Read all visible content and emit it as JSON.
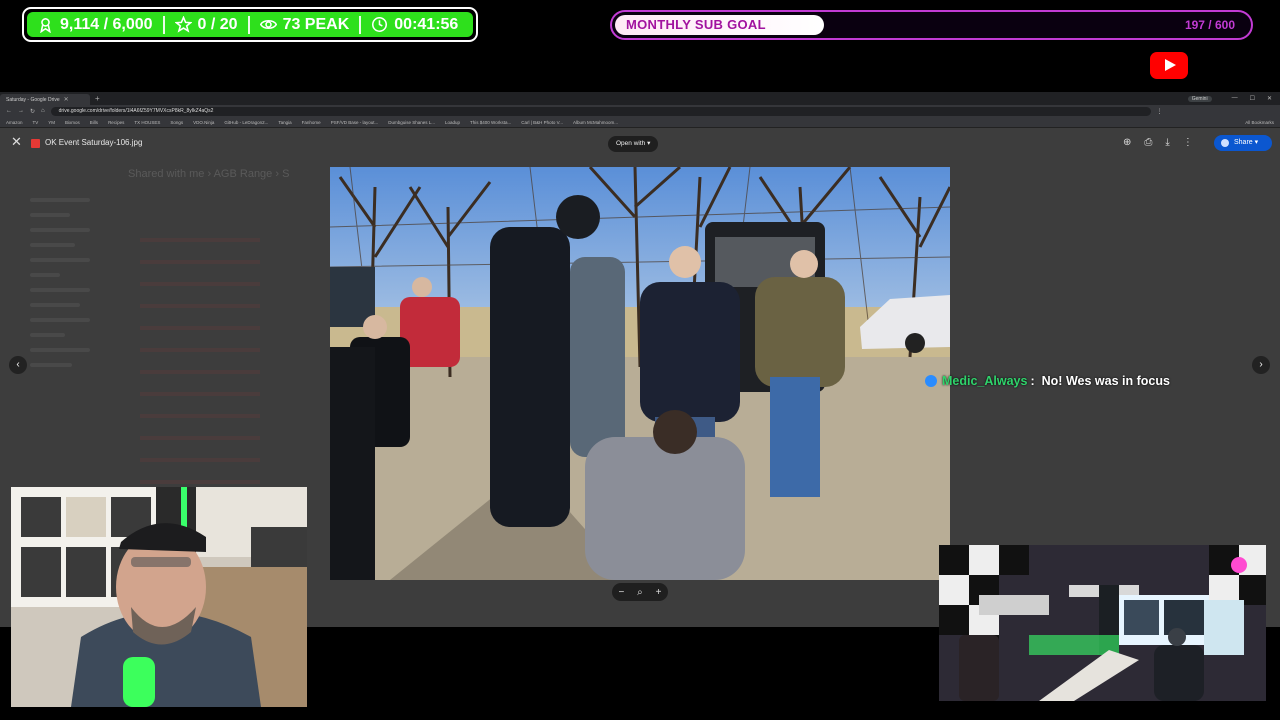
{
  "overlay": {
    "stats": {
      "followers": "9,114 / 6,000",
      "subs": "0 / 20",
      "peak_viewers": "73 PEAK",
      "uptime": "00:41:56"
    },
    "sub_goal": {
      "label": "MONTHLY SUB GOAL",
      "count": "197 / 600",
      "progress": 0.33
    }
  },
  "browser": {
    "tab_title": "Saturday - Google Drive",
    "url": "drive.google.com/drive/folders/1l4A6fZ59Y7MVXcsP8kR_8yIkZ4aQs2",
    "gemini": "Gemini",
    "bookmarks": [
      "Amazon",
      "TV",
      "YM",
      "Bixmos",
      "Bills",
      "Recipes",
      "TX HOUSES",
      "Songs",
      "VDO.Ninja",
      "GitHub - LeDragon2...",
      "Tangia",
      "Fanhome",
      "PSF/VD Base - layout...",
      "Dumbguise Shanes L...",
      "Loadup",
      "This $400 Worksta...",
      "Carl | B&H Photo V...",
      "Album McMahmoom..."
    ],
    "all_bookmarks": "All Bookmarks"
  },
  "viewer": {
    "file_name": "OK Event Saturday-106.jpg",
    "open_with": "Open with",
    "share_label": "Share",
    "ghost_title": "Shared with me  ›  AGB Range  ›  S"
  },
  "chat": {
    "username": "Medic_Always",
    "separator": ":",
    "message": "No! Wes was in focus"
  },
  "colors": {
    "stats_green": "#2ee01c",
    "goal_purple": "#c23bd4",
    "share_blue": "#0b57d0",
    "chat_user": "#2fd36b"
  }
}
